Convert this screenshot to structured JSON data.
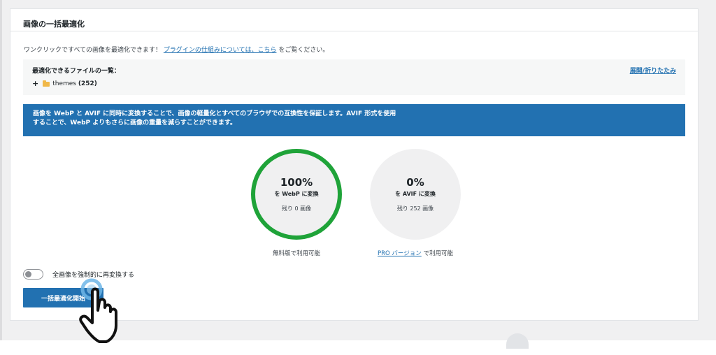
{
  "panel": {
    "title": "画像の一括最適化"
  },
  "intro": {
    "text_before": "ワンクリックですべての画像を最適化できます！",
    "link": "プラグインの仕組みについては、こちら",
    "text_after": "をご覧ください。"
  },
  "files": {
    "title": "最適化できるファイルの一覧：",
    "toggle": "展開/折りたたみ",
    "tree": [
      {
        "icon": "folder-icon",
        "name": "themes",
        "count": "(252)"
      }
    ]
  },
  "banner": {
    "line1": "画像を WebP と AVIF に同時に変換することで、画像の軽量化とすべてのブラウザでの互換性を保証します。AVIF 形式を使用",
    "line2": "することで、WebP よりもさらに画像の重量を減らすことができます。"
  },
  "stats": {
    "webp": {
      "percent": "100%",
      "label": "を WebP に変換",
      "remaining": "残り 0 画像",
      "availability": "無料版で利用可能",
      "progress": 1.0,
      "ring_color": "#1fa339"
    },
    "avif": {
      "percent": "0%",
      "label": "を AVIF に変換",
      "remaining": "残り 252 画像",
      "availability_link": "PRO バージョン",
      "availability_text": "で利用可能",
      "progress": 0.0
    }
  },
  "options": {
    "force_label": "全画像を強制的に再変換する",
    "force_enabled": false
  },
  "actions": {
    "start_button": "一括最適化開始"
  },
  "colors": {
    "accent": "#2271b1",
    "success": "#1fa339",
    "background": "#f0f0f1"
  },
  "overlay": {
    "cursor_icon": "hand-pointer-icon"
  }
}
